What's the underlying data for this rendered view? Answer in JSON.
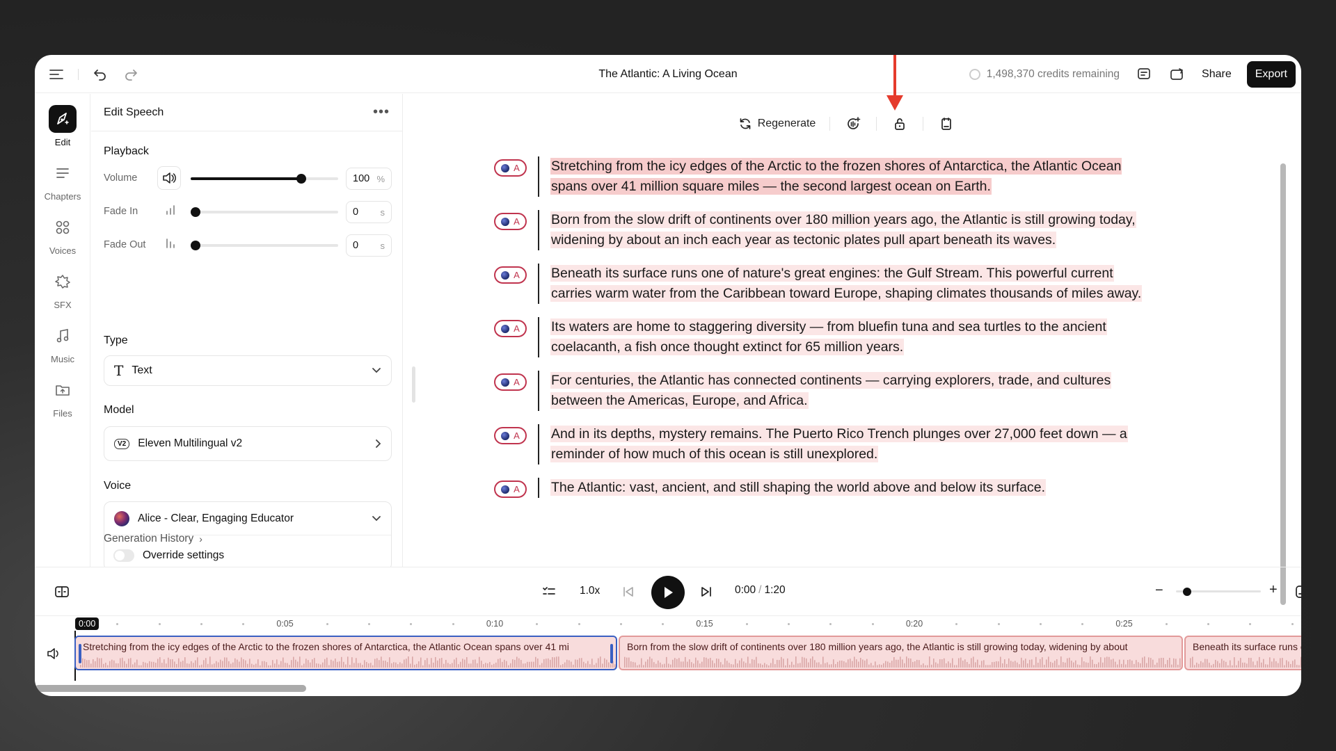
{
  "topbar": {
    "title": "The Atlantic: A Living Ocean",
    "credits": "1,498,370 credits remaining",
    "share_label": "Share",
    "export_label": "Export"
  },
  "rail": [
    {
      "label": "Edit",
      "icon": "pen-sparkle-icon",
      "active": true
    },
    {
      "label": "Chapters",
      "icon": "lines-icon"
    },
    {
      "label": "Voices",
      "icon": "grid-circles-icon"
    },
    {
      "label": "SFX",
      "icon": "sun-icon"
    },
    {
      "label": "Music",
      "icon": "music-note-icon"
    },
    {
      "label": "Files",
      "icon": "folder-icon"
    }
  ],
  "panel": {
    "title": "Edit Speech",
    "playback": {
      "title": "Playback",
      "volume_label": "Volume",
      "volume_value": "100",
      "volume_unit": "%",
      "volume_level": 0.75,
      "fade_in_label": "Fade In",
      "fade_in_value": "0",
      "fade_in_unit": "s",
      "fade_out_label": "Fade Out",
      "fade_out_value": "0",
      "fade_out_unit": "s"
    },
    "type": {
      "title": "Type",
      "value": "Text"
    },
    "model": {
      "title": "Model",
      "badge": "V2",
      "value": "Eleven Multilingual v2"
    },
    "voice": {
      "title": "Voice",
      "value": "Alice - Clear, Engaging Educator",
      "override_label": "Override settings"
    },
    "history_label": "Generation History"
  },
  "editor": {
    "regenerate_label": "Regenerate",
    "badge_letter": "A",
    "paragraphs": [
      {
        "lines": [
          "Stretching from the icy edges of the Arctic to the frozen shores of Antarctica, the Atlantic Ocean",
          "spans over 41 million square miles — the second largest ocean on Earth."
        ],
        "selected": true
      },
      {
        "lines": [
          "Born from the slow drift of continents over 180 million years ago, the Atlantic is still growing today,",
          "widening by about an inch each year as tectonic plates pull apart beneath its waves."
        ]
      },
      {
        "lines": [
          "Beneath its surface runs one of nature's great engines: the Gulf Stream. This powerful current",
          "carries warm water from the Caribbean toward Europe, shaping climates thousands of miles away."
        ]
      },
      {
        "lines": [
          "Its waters are home to staggering diversity — from bluefin tuna and sea turtles to the ancient",
          "coelacanth, a fish once thought extinct for 65 million years."
        ]
      },
      {
        "lines": [
          "For centuries, the Atlantic has connected continents — carrying explorers, trade, and cultures",
          "between the Americas, Europe, and Africa."
        ]
      },
      {
        "lines": [
          "And in its depths, mystery remains. The Puerto Rico Trench plunges over 27,000 feet down — a",
          "reminder of how much of this ocean is still unexplored."
        ]
      },
      {
        "lines": [
          "The Atlantic: vast, ancient, and still shaping the world above and below its surface."
        ]
      }
    ]
  },
  "player": {
    "speed": "1.0x",
    "time_current": "0:00",
    "time_sep": "/",
    "time_total": "1:20",
    "zoom_level": 0.05
  },
  "timeline": {
    "playhead": "0:00",
    "ticks": [
      "0:05",
      "0:10",
      "0:15",
      "0:20",
      "0:25"
    ],
    "clips": [
      {
        "text": "Stretching from the icy edges of the Arctic to the frozen shores of Antarctica, the Atlantic Ocean spans over 41 mi",
        "selected": true
      },
      {
        "text": "Born from the slow drift of continents over 180 million years ago, the Atlantic is still growing today, widening by about"
      },
      {
        "text": "Beneath its surface runs one of nature's great engines"
      }
    ]
  },
  "colors": {
    "accent": "#c0344e",
    "clip_bg": "#f8dcdc",
    "highlight": "#fbe6e6",
    "annotation_arrow": "#e53b2c"
  }
}
